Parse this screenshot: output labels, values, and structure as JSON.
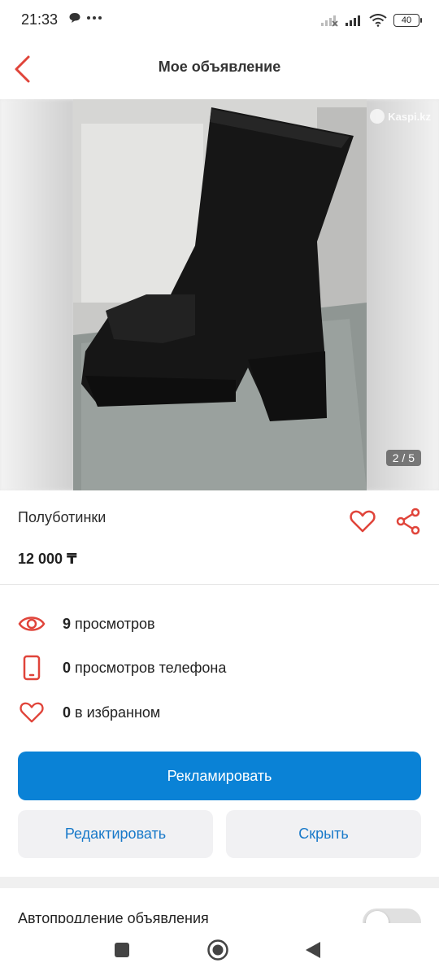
{
  "status_bar": {
    "time": "21:33",
    "left_icons": [
      "chat-bubble-icon",
      "more-dots-icon"
    ],
    "right_icons": [
      "signal-icon",
      "signal-icon",
      "wifi-icon"
    ],
    "battery": "40"
  },
  "header": {
    "title": "Мое объявление",
    "back_icon": "chevron-left-icon"
  },
  "gallery": {
    "counter": "2 / 5",
    "watermark": "Kaspi.kz"
  },
  "listing": {
    "title": "Полуботинки",
    "price": "12 000 ₸"
  },
  "stats": [
    {
      "value": "9",
      "label": "просмотров",
      "icon": "eye-icon"
    },
    {
      "value": "0",
      "label": "просмотров телефона",
      "icon": "phone-icon"
    },
    {
      "value": "0",
      "label": "в избранном",
      "icon": "heart-icon"
    }
  ],
  "actions": {
    "promote": "Рекламировать",
    "edit": "Редактировать",
    "hide": "Скрыть"
  },
  "autorenew": {
    "label": "Автопродление объявления",
    "enabled": false
  },
  "colors": {
    "accent_red": "#e0443a",
    "primary_blue": "#0a82d6",
    "link_blue": "#1879c9"
  }
}
